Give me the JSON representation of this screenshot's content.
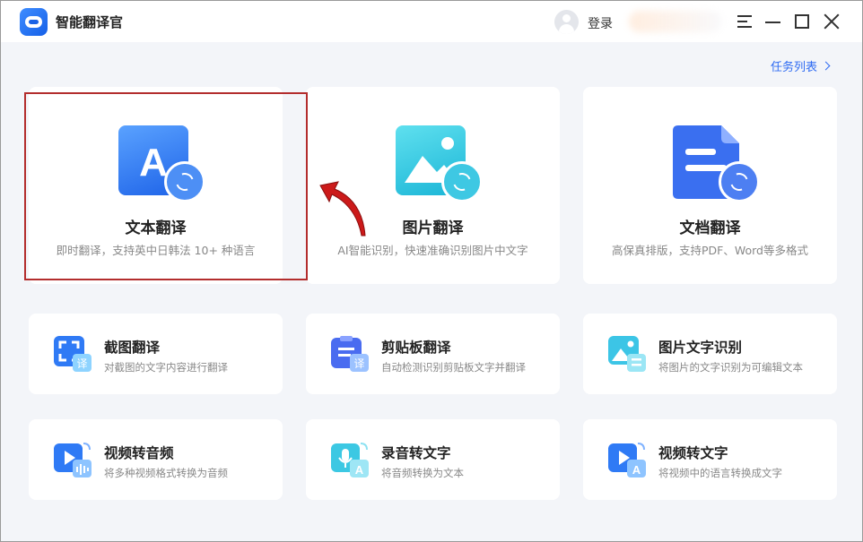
{
  "app": {
    "title": "智能翻译官"
  },
  "header": {
    "login_label": "登录"
  },
  "tasklist": {
    "label": "任务列表"
  },
  "big_cards": [
    {
      "title": "文本翻译",
      "desc": "即时翻译，支持英中日韩法 10+ 种语言",
      "icon": "text-translate-icon"
    },
    {
      "title": "图片翻译",
      "desc": "AI智能识别，快速准确识别图片中文字",
      "icon": "image-translate-icon"
    },
    {
      "title": "文档翻译",
      "desc": "高保真排版，支持PDF、Word等多格式",
      "icon": "document-translate-icon"
    }
  ],
  "small_cards": [
    {
      "title": "截图翻译",
      "desc": "对截图的文字内容进行翻译",
      "icon": "screenshot-translate-icon"
    },
    {
      "title": "剪贴板翻译",
      "desc": "自动检测识别剪贴板文字并翻译",
      "icon": "clipboard-translate-icon"
    },
    {
      "title": "图片文字识别",
      "desc": "将图片的文字识别为可编辑文本",
      "icon": "image-ocr-icon"
    },
    {
      "title": "视频转音频",
      "desc": "将多种视频格式转换为音频",
      "icon": "video-to-audio-icon"
    },
    {
      "title": "录音转文字",
      "desc": "将音频转换为文本",
      "icon": "audio-to-text-icon"
    },
    {
      "title": "视频转文字",
      "desc": "将视频中的语言转换成文字",
      "icon": "video-to-text-icon"
    }
  ],
  "colors": {
    "accent": "#2f6bf2",
    "highlight_box": "#b32d2d",
    "annotation_arrow": "#cc1a1a",
    "background": "#f3f5f9"
  }
}
